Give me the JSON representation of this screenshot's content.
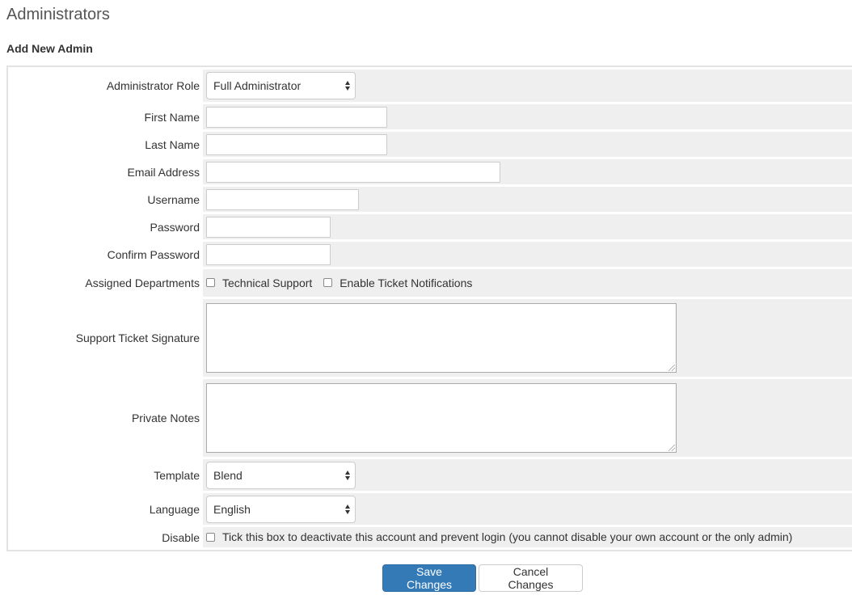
{
  "page": {
    "title": "Administrators",
    "section": "Add New Admin"
  },
  "form": {
    "role": {
      "label": "Administrator Role",
      "value": "Full Administrator"
    },
    "first_name": {
      "label": "First Name",
      "value": ""
    },
    "last_name": {
      "label": "Last Name",
      "value": ""
    },
    "email": {
      "label": "Email Address",
      "value": ""
    },
    "username": {
      "label": "Username",
      "value": ""
    },
    "password": {
      "label": "Password",
      "value": ""
    },
    "confirm_password": {
      "label": "Confirm Password",
      "value": ""
    },
    "departments": {
      "label": "Assigned Departments",
      "options": [
        {
          "label": "Technical Support",
          "checked": false
        },
        {
          "label": "Enable Ticket Notifications",
          "checked": false
        }
      ]
    },
    "signature": {
      "label": "Support Ticket Signature",
      "value": ""
    },
    "notes": {
      "label": "Private Notes",
      "value": ""
    },
    "template": {
      "label": "Template",
      "value": "Blend"
    },
    "language": {
      "label": "Language",
      "value": "English"
    },
    "disable": {
      "label": "Disable",
      "checkbox_label": "Tick this box to deactivate this account and prevent login (you cannot disable your own account or the only admin)",
      "checked": false
    }
  },
  "buttons": {
    "save": "Save Changes",
    "cancel": "Cancel Changes"
  },
  "colors": {
    "primary": "#337ab7",
    "field_bg": "#efefef"
  }
}
